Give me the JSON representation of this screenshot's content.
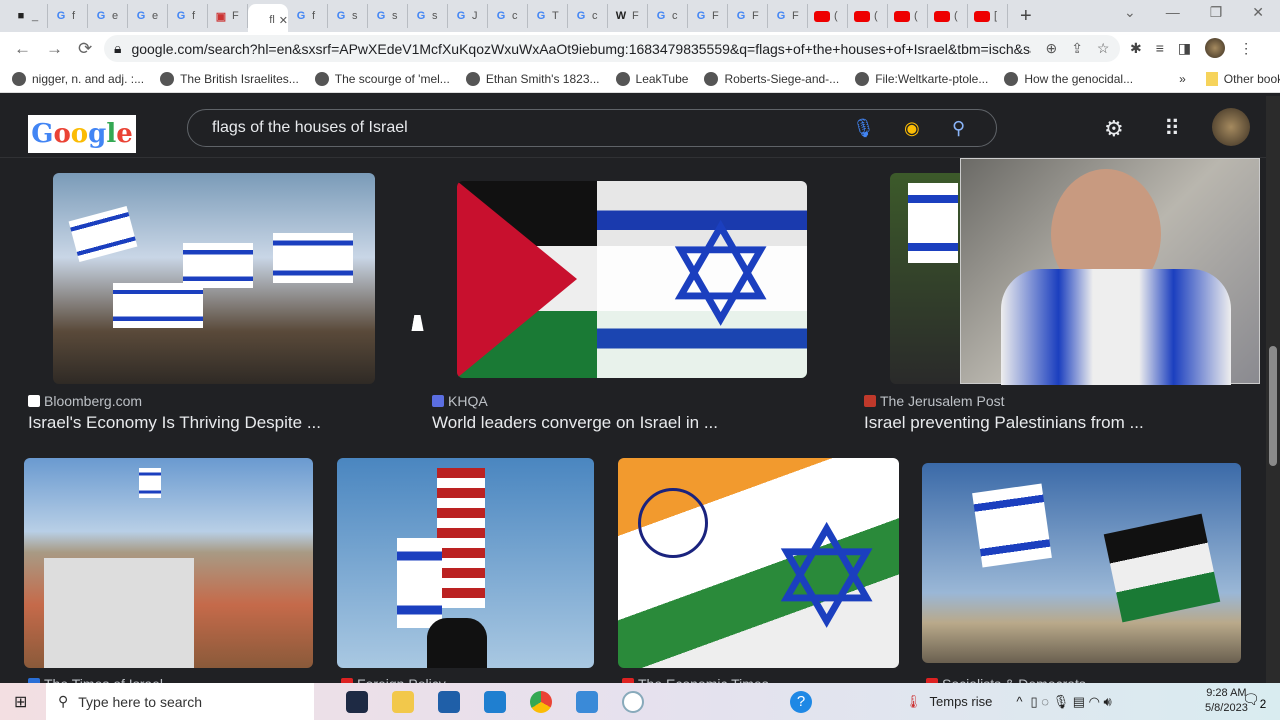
{
  "browser": {
    "tabs": [
      {
        "label": "_",
        "icon": "bbc-icon"
      },
      {
        "label": "f",
        "icon": "google-icon"
      },
      {
        "label": "e",
        "icon": "google-icon"
      },
      {
        "label": "e",
        "icon": "google-icon"
      },
      {
        "label": "f",
        "icon": "google-icon"
      },
      {
        "label": "F",
        "icon": "page-icon"
      },
      {
        "label": "fl",
        "icon": "none",
        "active": true
      },
      {
        "label": "f",
        "icon": "google-icon"
      },
      {
        "label": "s",
        "icon": "google-icon"
      },
      {
        "label": "s",
        "icon": "google-icon"
      },
      {
        "label": "s",
        "icon": "google-icon"
      },
      {
        "label": "J",
        "icon": "google-icon"
      },
      {
        "label": "c",
        "icon": "google-icon"
      },
      {
        "label": "T",
        "icon": "google-icon"
      },
      {
        "label": "c",
        "icon": "google-icon"
      },
      {
        "label": "F",
        "icon": "wikipedia-icon"
      },
      {
        "label": "c",
        "icon": "google-icon"
      },
      {
        "label": "F",
        "icon": "google-icon"
      },
      {
        "label": "F",
        "icon": "google-icon"
      },
      {
        "label": "F",
        "icon": "google-icon"
      },
      {
        "label": "(",
        "icon": "youtube-icon"
      },
      {
        "label": "(",
        "icon": "youtube-icon"
      },
      {
        "label": "(",
        "icon": "youtube-icon"
      },
      {
        "label": "(",
        "icon": "youtube-icon"
      },
      {
        "label": "[",
        "icon": "youtube-icon"
      }
    ],
    "url": "google.com/search?hl=en&sxsrf=APwXEdeV1McfXuKqozWxuWxAaOt9iebumg:1683479835559&q=flags+of+the+houses+of+Israel&tbm=isch&sa=X&...",
    "bookmarks": [
      "nigger, n. and adj. :...",
      "The British Israelites...",
      "The scourge of 'mel...",
      "Ethan Smith's 1823...",
      "LeakTube",
      "Roberts-Siege-and-...",
      "File:Weltkarte-ptole...",
      "How the genocidal..."
    ],
    "bookmarks_overflow": "»",
    "other_bookmarks": "Other bookmarks"
  },
  "google": {
    "logo": "Google",
    "query": "flags of the houses of Israel"
  },
  "results": [
    {
      "source": "Bloomberg.com",
      "title": "Israel's Economy Is Thriving Despite ...",
      "favicon_color": "#ffffff"
    },
    {
      "source": "KHQA",
      "title": "World leaders converge on Israel in ...",
      "favicon_color": "#5b6ee1"
    },
    {
      "source": "The Jerusalem Post",
      "title": "Israel preventing Palestinians from ...",
      "favicon_color": "#c0392b"
    },
    {
      "source": "The Times of Israel",
      "favicon_color": "#2a6fd6"
    },
    {
      "source": "Foreign Policy",
      "favicon_color": "#d22"
    },
    {
      "source": "The Economic Times",
      "favicon_color": "#d22"
    },
    {
      "source": "Socialists & Democrats",
      "favicon_color": "#d22"
    }
  ],
  "taskbar": {
    "search_placeholder": "Type here to search",
    "weather": "Temps rise",
    "time": "9:28 AM",
    "date": "5/8/2023",
    "notifications": "2"
  }
}
